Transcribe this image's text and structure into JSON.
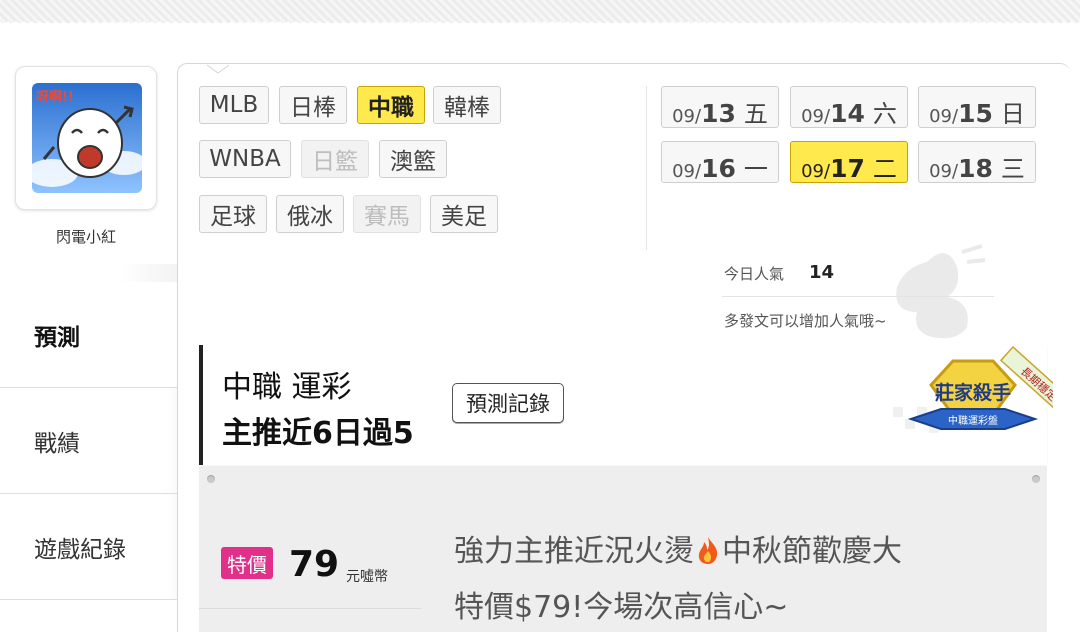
{
  "user": {
    "name": "閃電小紅",
    "avatar_text": "呀啊!!"
  },
  "sidebar": {
    "items": [
      {
        "label": "預測",
        "active": true
      },
      {
        "label": "戰績",
        "active": false
      },
      {
        "label": "遊戲紀錄",
        "active": false
      }
    ]
  },
  "leagues": {
    "row1": [
      "MLB",
      "日棒",
      "中職",
      "韓棒"
    ],
    "row2": [
      "WNBA",
      "日籃",
      "澳籃"
    ],
    "row3": [
      "足球",
      "俄冰",
      "賽馬",
      "美足"
    ],
    "selected": "中職",
    "disabled": [
      "日籃",
      "賽馬"
    ]
  },
  "dates": [
    {
      "md": "09/",
      "day": "13",
      "weekday": "五"
    },
    {
      "md": "09/",
      "day": "14",
      "weekday": "六"
    },
    {
      "md": "09/",
      "day": "15",
      "weekday": "日"
    },
    {
      "md": "09/",
      "day": "16",
      "weekday": "一"
    },
    {
      "md": "09/",
      "day": "17",
      "weekday": "二"
    },
    {
      "md": "09/",
      "day": "18",
      "weekday": "三"
    }
  ],
  "selected_date": "17",
  "popularity": {
    "label": "今日人氣",
    "value": "14",
    "hint": "多發文可以增加人氣哦~"
  },
  "card": {
    "title_line1": "中職 運彩",
    "title_line2": "主推近6日過5",
    "record_button": "預測記錄",
    "badge_main": "莊家殺手",
    "badge_sub": "中職運彩盤",
    "ribbon": "長期穩定"
  },
  "offer": {
    "tag": "特價",
    "price": "79",
    "unit": "元噓幣",
    "promo_line1a": "強力主推近況火燙",
    "promo_line1b": "中秋節歡慶大",
    "promo_line2": "特價$79!今場次高信心~"
  },
  "colors": {
    "selected": "#ffe94d",
    "price_tag": "#e0308a",
    "badge_gold": "#e8c12a",
    "badge_blue": "#2b63c7"
  },
  "icons": [
    "flame-icon",
    "avatar-illustration",
    "popularity-watermark-icon",
    "award-badge-icon"
  ]
}
